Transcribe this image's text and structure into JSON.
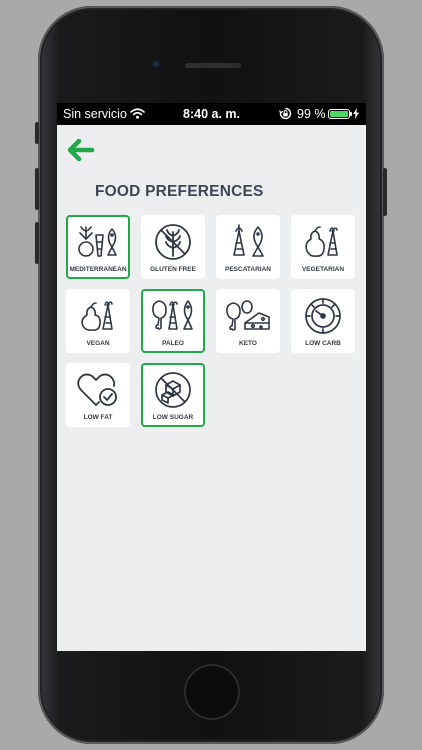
{
  "status_bar": {
    "carrier": "Sin servicio",
    "time": "8:40 a. m.",
    "battery_percent": "99 %",
    "battery_level": 0.99,
    "wifi_icon": "wifi-icon",
    "lock_icon": "rotation-lock-icon",
    "charging_icon": "charging-bolt-icon"
  },
  "header": {
    "back_icon": "back-arrow-icon",
    "title": "FOOD PREFERENCES"
  },
  "colors": {
    "accent": "#22a84a",
    "title": "#3f4656",
    "icon_stroke": "#2f3744",
    "screen_bg": "#eceef0",
    "tile_bg": "#ffffff"
  },
  "preferences": [
    {
      "label": "MEDITERRANEAN",
      "icon": "mediterranean-icon",
      "selected": true
    },
    {
      "label": "GLUTEN FREE",
      "icon": "gluten-free-icon",
      "selected": false
    },
    {
      "label": "PESCATARIAN",
      "icon": "pescatarian-icon",
      "selected": false
    },
    {
      "label": "VEGETARIAN",
      "icon": "vegetarian-icon",
      "selected": false
    },
    {
      "label": "VEGAN",
      "icon": "vegan-icon",
      "selected": false
    },
    {
      "label": "PALEO",
      "icon": "paleo-icon",
      "selected": true
    },
    {
      "label": "KETO",
      "icon": "keto-icon",
      "selected": false
    },
    {
      "label": "LOW CARB",
      "icon": "low-carb-icon",
      "selected": false
    },
    {
      "label": "LOW FAT",
      "icon": "low-fat-icon",
      "selected": false
    },
    {
      "label": "LOW SUGAR",
      "icon": "low-sugar-icon",
      "selected": true
    }
  ]
}
